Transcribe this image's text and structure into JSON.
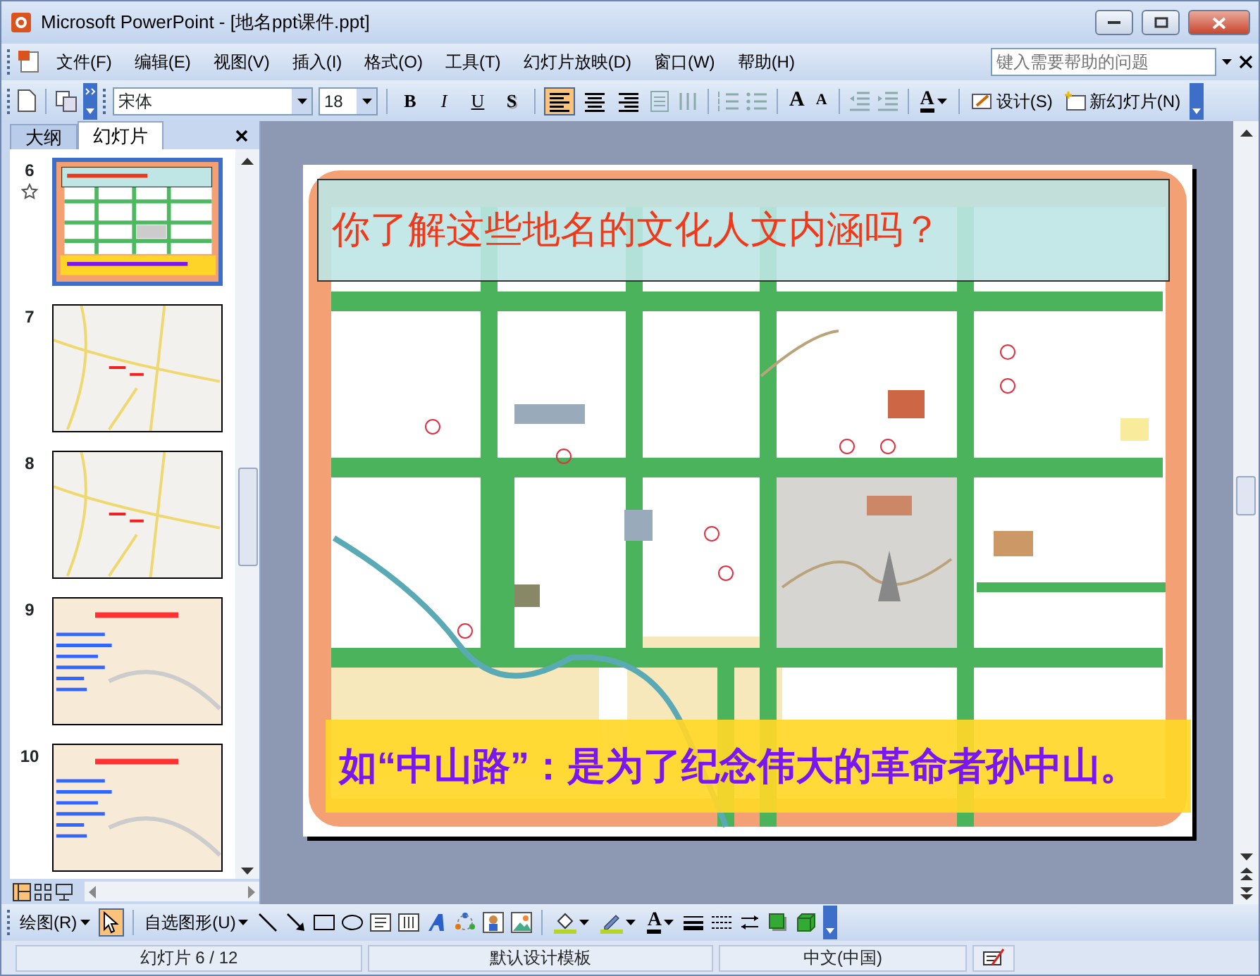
{
  "window": {
    "title": "Microsoft PowerPoint - [地名ppt课件.ppt]"
  },
  "menu": {
    "items": [
      {
        "label": "文件(F)"
      },
      {
        "label": "编辑(E)"
      },
      {
        "label": "视图(V)"
      },
      {
        "label": "插入(I)"
      },
      {
        "label": "格式(O)"
      },
      {
        "label": "工具(T)"
      },
      {
        "label": "幻灯片放映(D)"
      },
      {
        "label": "窗口(W)"
      },
      {
        "label": "帮助(H)"
      }
    ],
    "help_box": {
      "placeholder": "键入需要帮助的问题"
    }
  },
  "toolbar": {
    "font": "宋体",
    "font_size": "18",
    "style_buttons": [
      "B",
      "I",
      "U",
      "S"
    ],
    "alignment": [
      {
        "kind": "left",
        "selected": true
      },
      {
        "kind": "center",
        "selected": false
      },
      {
        "kind": "right",
        "selected": false
      }
    ],
    "font_grow": "A",
    "font_shrink": "A",
    "font_color": "A",
    "design": "设计(S)",
    "new_slide": "新幻灯片(N)"
  },
  "side_panel": {
    "tabs": [
      {
        "label": "大纲",
        "selected": false
      },
      {
        "label": "幻灯片",
        "selected": true
      }
    ],
    "thumbnails": [
      {
        "number": "6",
        "kind": "map",
        "selected": true,
        "starred": true
      },
      {
        "number": "7",
        "kind": "roads",
        "selected": false,
        "starred": false
      },
      {
        "number": "8",
        "kind": "roads",
        "selected": false,
        "starred": false
      },
      {
        "number": "9",
        "kind": "text",
        "selected": false,
        "starred": false
      },
      {
        "number": "10",
        "kind": "text",
        "selected": false,
        "starred": false
      }
    ]
  },
  "slide": {
    "title": "你了解这些地名的文化人文内涵吗？",
    "caption": "如“中山路”：是为了纪念伟大的革命者孙中山。"
  },
  "drawing_toolbar": {
    "draw_menu": "绘图(R)",
    "autoshapes": "自选图形(U)",
    "pointer_selected": true,
    "font_color": "A"
  },
  "status_bar": [
    "幻灯片 6 / 12",
    "默认设计模板",
    "中文(中国)"
  ]
}
